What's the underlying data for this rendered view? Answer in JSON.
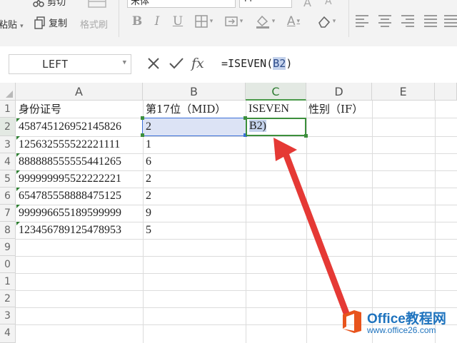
{
  "ribbon": {
    "cut_label": "剪切",
    "paste_label": "粘贴",
    "copy_label": "复制",
    "format_painter_label": "格式刷",
    "font_name": "宋体"
  },
  "formula_bar": {
    "name_box": "LEFT",
    "formula_prefix": "=ISEVEN(",
    "formula_ref": "B2",
    "formula_suffix": ")"
  },
  "columns": [
    "A",
    "B",
    "C",
    "D",
    "E"
  ],
  "rows": [
    "1",
    "2",
    "3",
    "4",
    "5",
    "6",
    "7",
    "8",
    "9",
    "0",
    "1",
    "2",
    "3",
    "4"
  ],
  "headers": {
    "a1": "身份证号",
    "b1": "第17位（MID）",
    "c1": "ISEVEN",
    "d1": "性别（IF）"
  },
  "table_rows": [
    {
      "id": "458745126952145826",
      "digit": "2"
    },
    {
      "id": "125632555522221111",
      "digit": "1"
    },
    {
      "id": "888888555555441265",
      "digit": "6"
    },
    {
      "id": "999999995522222221",
      "digit": "2"
    },
    {
      "id": "654785558888475125",
      "digit": "2"
    },
    {
      "id": "999996655189599999",
      "digit": "9"
    },
    {
      "id": "123456789125478953",
      "digit": "5"
    }
  ],
  "editing_cell": {
    "ref": "B2",
    "suffix": ")"
  },
  "watermark": {
    "title": "Office教程网",
    "url": "www.office26.com"
  },
  "colors": {
    "accent_green": "#3c8f3c",
    "arrow_red": "#e53935",
    "selection_blue": "#3b6fd8"
  }
}
